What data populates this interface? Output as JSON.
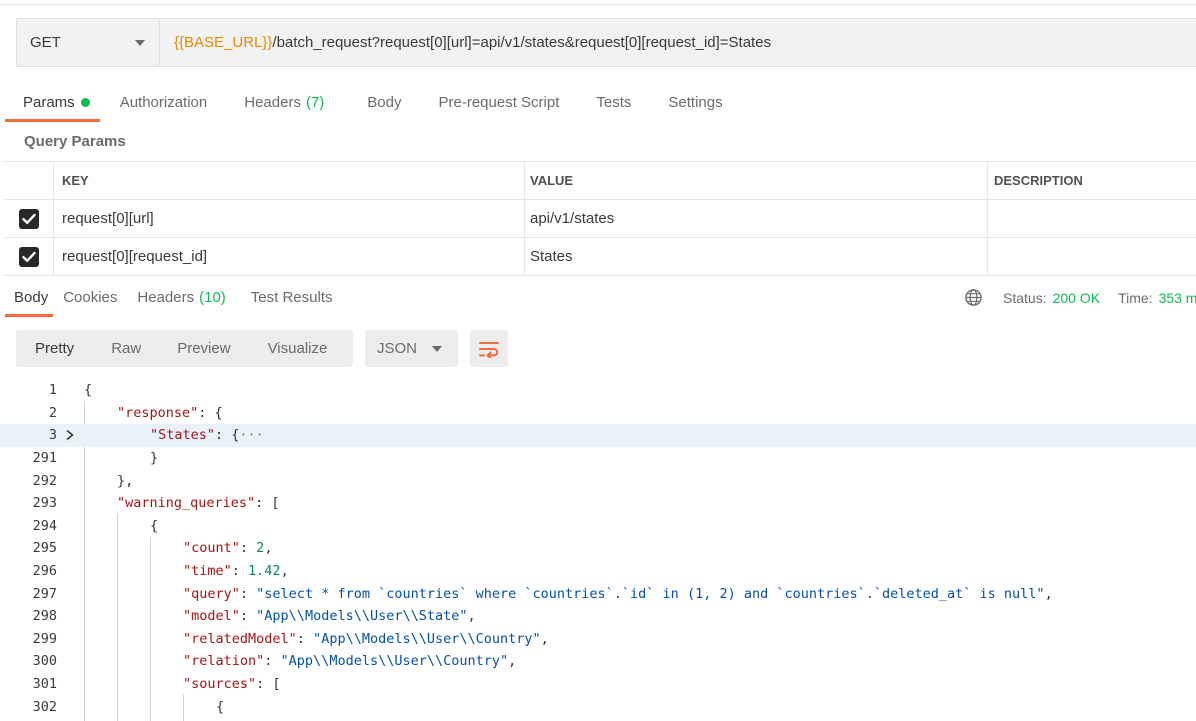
{
  "request": {
    "method": "GET",
    "url_variable": "{{BASE_URL}}",
    "url_path": "/batch_request?request[0][url]=api/v1/states&request[0][request_id]=States"
  },
  "request_tabs": [
    {
      "label": "Params",
      "active": true,
      "dot": true
    },
    {
      "label": "Authorization"
    },
    {
      "label": "Headers",
      "count": "(7)"
    },
    {
      "label": "Body"
    },
    {
      "label": "Pre-request Script"
    },
    {
      "label": "Tests"
    },
    {
      "label": "Settings"
    }
  ],
  "query_params": {
    "title": "Query Params",
    "columns": [
      "KEY",
      "VALUE",
      "DESCRIPTION"
    ],
    "rows": [
      {
        "checked": true,
        "key": "request[0][url]",
        "value": "api/v1/states",
        "description": ""
      },
      {
        "checked": true,
        "key": "request[0][request_id]",
        "value": "States",
        "description": ""
      }
    ]
  },
  "response_tabs": [
    {
      "label": "Body",
      "active": true
    },
    {
      "label": "Cookies"
    },
    {
      "label": "Headers",
      "count": "(10)"
    },
    {
      "label": "Test Results"
    }
  ],
  "response_status": {
    "status_label": "Status:",
    "status_value": "200 OK",
    "time_label": "Time:",
    "time_value": "353 m"
  },
  "format_toolbar": {
    "views": [
      "Pretty",
      "Raw",
      "Preview",
      "Visualize"
    ],
    "active_view": "Pretty",
    "language": "JSON"
  },
  "code_lines": [
    {
      "n": "1",
      "indent": 0,
      "text": "{"
    },
    {
      "n": "2",
      "indent": 1,
      "key": "\"response\"",
      "rest": ": {"
    },
    {
      "n": "3",
      "indent": 2,
      "key": "\"States\"",
      "rest": ": {",
      "ellipsis": "···",
      "folded": true,
      "highlight": true
    },
    {
      "n": "291",
      "indent": 2,
      "text": "}"
    },
    {
      "n": "292",
      "indent": 1,
      "text": "},"
    },
    {
      "n": "293",
      "indent": 1,
      "key": "\"warning_queries\"",
      "rest": ": ["
    },
    {
      "n": "294",
      "indent": 2,
      "text": "{"
    },
    {
      "n": "295",
      "indent": 3,
      "key": "\"count\"",
      "rest": ": ",
      "num": "2",
      "tail": ","
    },
    {
      "n": "296",
      "indent": 3,
      "key": "\"time\"",
      "rest": ": ",
      "num": "1.42",
      "tail": ","
    },
    {
      "n": "297",
      "indent": 3,
      "key": "\"query\"",
      "rest": ": ",
      "str": "\"select * from `countries` where `countries`.`id` in (1, 2) and `countries`.`deleted_at` is null\"",
      "tail": ","
    },
    {
      "n": "298",
      "indent": 3,
      "key": "\"model\"",
      "rest": ": ",
      "str": "\"App\\\\Models\\\\User\\\\State\"",
      "tail": ","
    },
    {
      "n": "299",
      "indent": 3,
      "key": "\"relatedModel\"",
      "rest": ": ",
      "str": "\"App\\\\Models\\\\User\\\\Country\"",
      "tail": ","
    },
    {
      "n": "300",
      "indent": 3,
      "key": "\"relation\"",
      "rest": ": ",
      "str": "\"App\\\\Models\\\\User\\\\Country\"",
      "tail": ","
    },
    {
      "n": "301",
      "indent": 3,
      "key": "\"sources\"",
      "rest": ": ["
    },
    {
      "n": "302",
      "indent": 4,
      "text": "{"
    }
  ],
  "icons": {
    "method_dropdown": "chevron-down-icon",
    "globe": "globe-icon",
    "wrap": "wrap-lines-icon",
    "fold": "chevron-right-icon",
    "checkbox": "checkmark-icon"
  },
  "colors": {
    "accent": "#f26b3a",
    "success": "#0cbb52",
    "variable": "#e68a00",
    "json_key": "#a31515",
    "json_string": "#0451a5",
    "json_number": "#098658"
  }
}
